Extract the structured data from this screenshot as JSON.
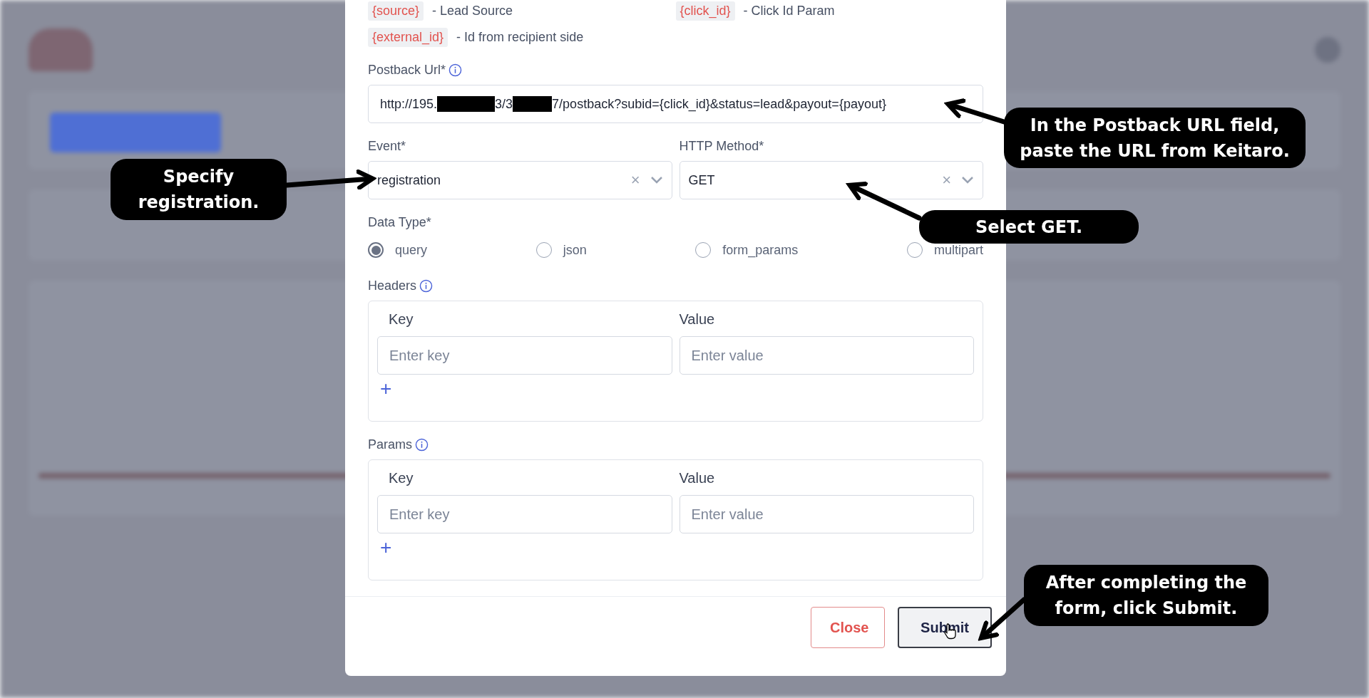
{
  "variables": [
    {
      "token": "{source}",
      "description": "- Lead Source"
    },
    {
      "token": "{click_id}",
      "description": "- Click Id Param"
    },
    {
      "token": "{external_id}",
      "description": "- Id from recipient side"
    }
  ],
  "postback_url": {
    "label": "Postback Url*",
    "parts": [
      {
        "kind": "text",
        "text": "http://195."
      },
      {
        "kind": "redacted"
      },
      {
        "kind": "text",
        "text": "3/3"
      },
      {
        "kind": "redacted"
      },
      {
        "kind": "text",
        "text": "7/postback?subid={click_id}&status=lead&payout={payout}"
      }
    ]
  },
  "event": {
    "label": "Event*",
    "value": "registration",
    "clear": "×"
  },
  "http_method": {
    "label": "HTTP Method*",
    "value": "GET",
    "clear": "×"
  },
  "data_type": {
    "label": "Data Type*",
    "options": [
      {
        "label": "query",
        "selected": true
      },
      {
        "label": "json",
        "selected": false
      },
      {
        "label": "form_params",
        "selected": false
      },
      {
        "label": "multipart",
        "selected": false
      }
    ]
  },
  "headers": {
    "label": "Headers",
    "key_label": "Key",
    "value_label": "Value",
    "key_placeholder": "Enter key",
    "value_placeholder": "Enter value",
    "add": "+"
  },
  "params": {
    "label": "Params",
    "key_label": "Key",
    "value_label": "Value",
    "key_placeholder": "Enter key",
    "value_placeholder": "Enter value",
    "add": "+"
  },
  "buttons": [
    {
      "label": "Close",
      "kind": "secondary"
    },
    {
      "label": "Submit",
      "kind": "primary"
    }
  ],
  "callouts": [
    {
      "text": "Specify\nregistration."
    },
    {
      "text": "In the Postback URL field,\npaste the URL from Keitaro."
    },
    {
      "text": "Select GET."
    },
    {
      "text": "After completing the\nform, click Submit."
    }
  ]
}
